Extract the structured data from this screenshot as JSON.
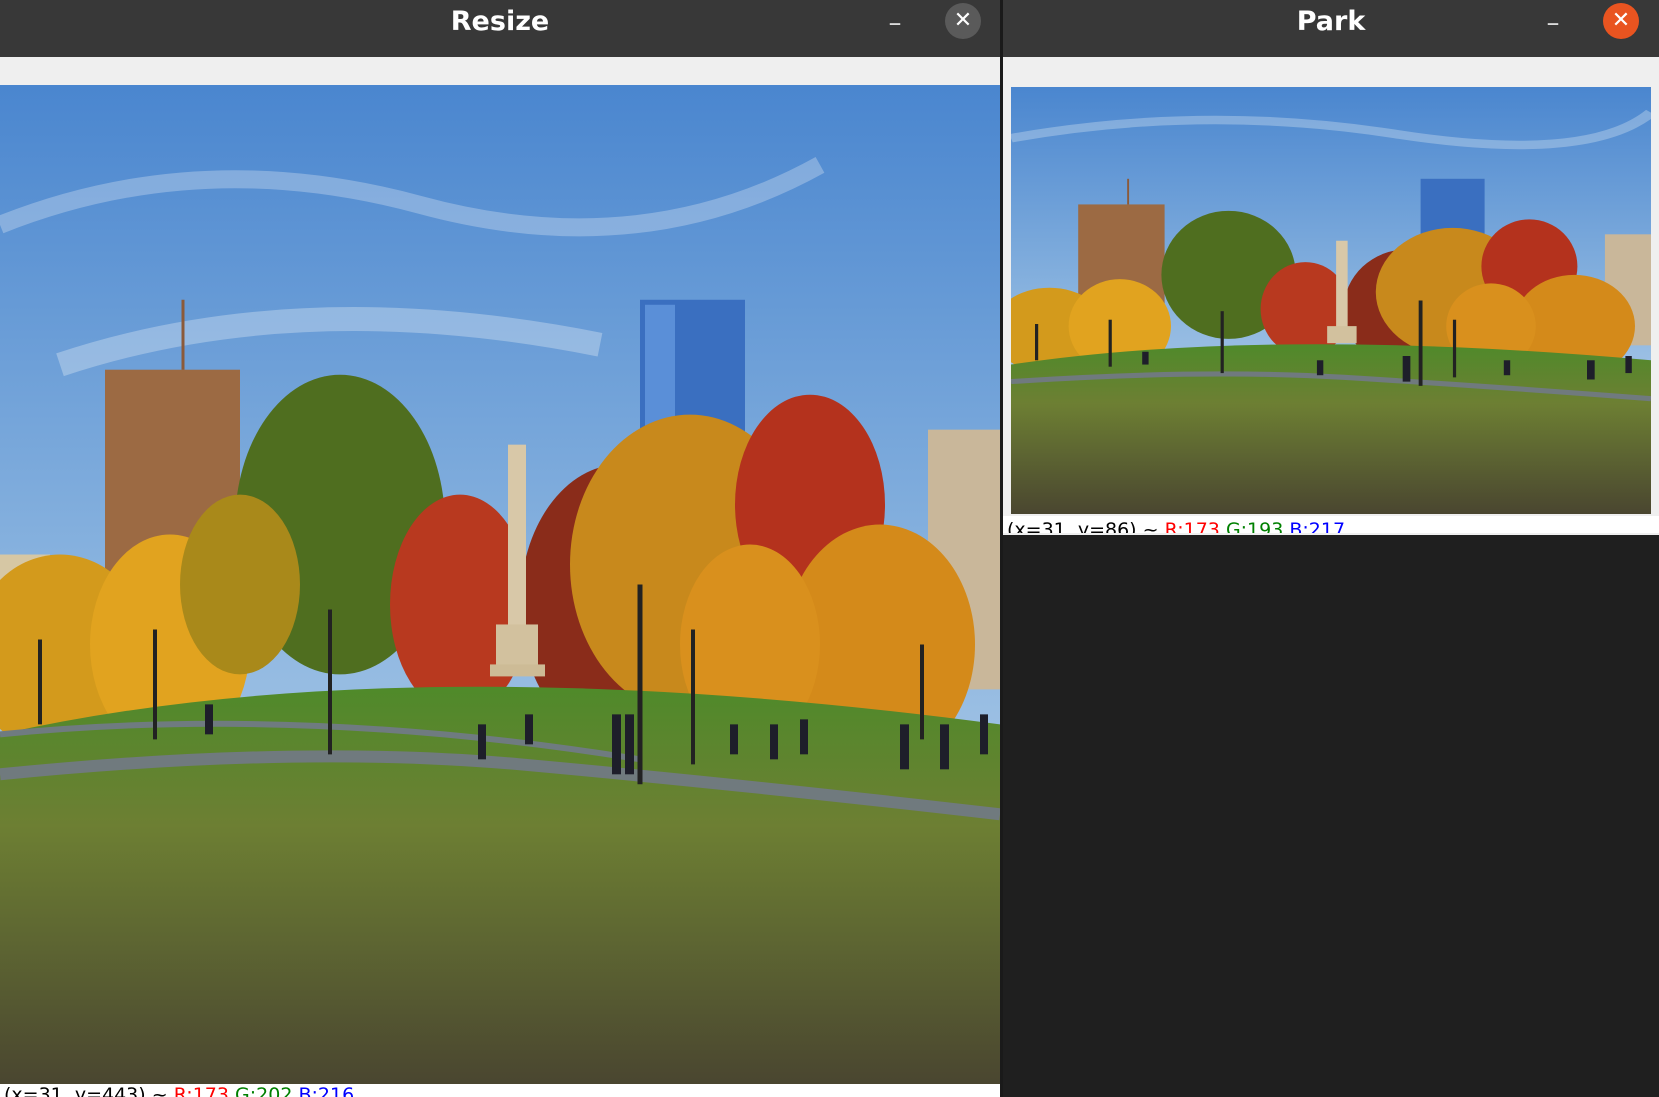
{
  "windows": {
    "resize": {
      "title": "Resize",
      "minimize_glyph": "–",
      "close_glyph": "✕",
      "status": {
        "coords": "(x=31, y=443) ~",
        "r": "R:173",
        "g": "G:202",
        "b": "B:216"
      }
    },
    "park": {
      "title": "Park",
      "minimize_glyph": "–",
      "close_glyph": "✕",
      "status": {
        "coords": "(x=31, y=86) ~",
        "r": "R:173",
        "g": "G:193",
        "b": "B:217"
      }
    }
  },
  "colors": {
    "titlebar": "#383838",
    "close_active": "#e95420",
    "close_inactive": "#5a5a5a",
    "desktop": "#1f1f1f"
  },
  "image": {
    "description_icon": "park-photo-autumn-trees-monument-skyline"
  }
}
